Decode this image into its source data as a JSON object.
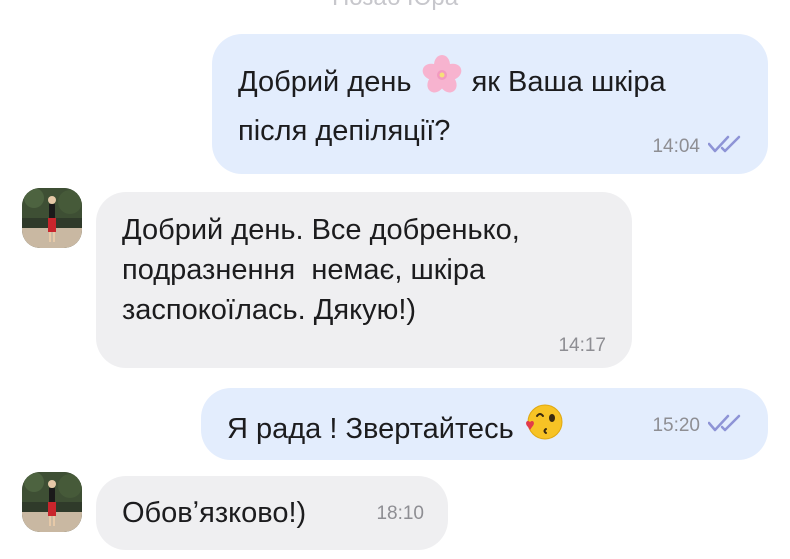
{
  "header": {
    "contact_name": "Нозаб Юра"
  },
  "messages": [
    {
      "direction": "outgoing",
      "text_before": "Добрий день",
      "emoji": "cherry-blossom",
      "text_after": "як Ваша шкіра",
      "line2": "після депіляції?",
      "time": "14:04",
      "status": "read"
    },
    {
      "direction": "incoming",
      "lines": [
        "Добрий день. Все добренько,",
        "подразнення  немає, шкіра",
        "заспокоїлась. Дякую!)"
      ],
      "time": "14:17"
    },
    {
      "direction": "outgoing",
      "text": "Я рада ! Звертайтесь",
      "emoji": "face-blowing-kiss",
      "time": "15:20",
      "status": "read"
    },
    {
      "direction": "incoming",
      "text": "Обовʼязково!)",
      "time": "18:10"
    }
  ],
  "colors": {
    "outgoing_bubble": "#e3edfd",
    "incoming_bubble": "#efeff1",
    "read_check": "#8e94d6",
    "timestamp": "#8e8e93"
  }
}
